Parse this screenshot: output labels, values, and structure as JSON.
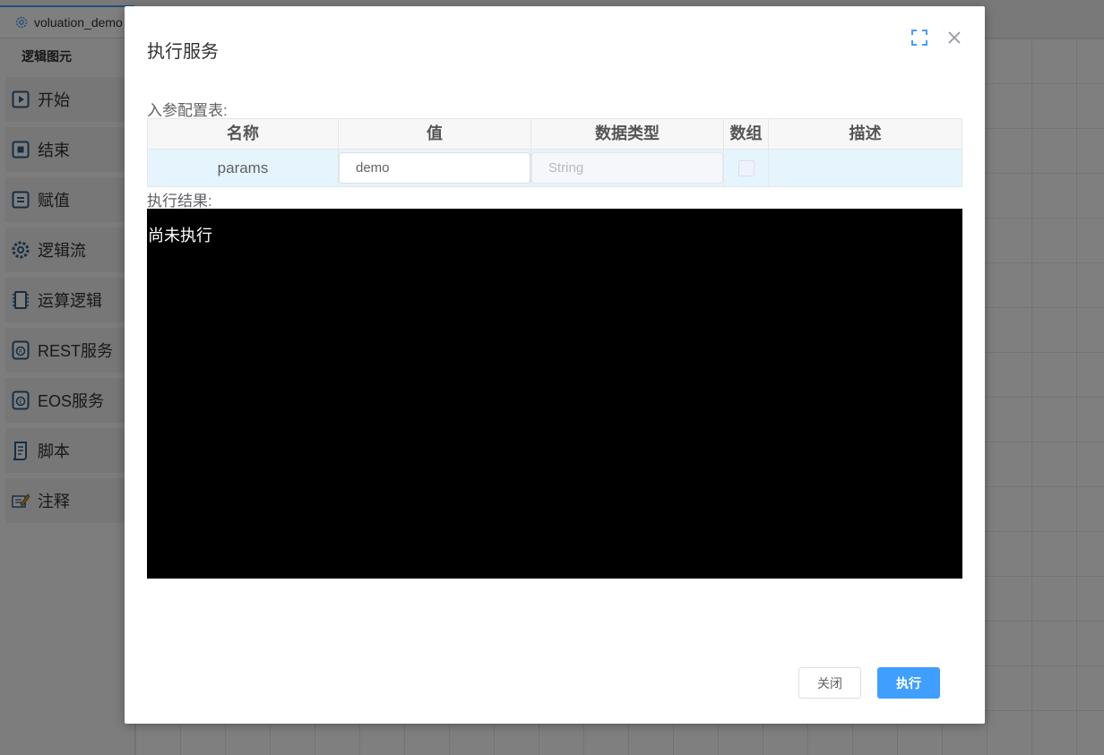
{
  "background": {
    "tab": {
      "label": "voluation_demo"
    },
    "sidebar": {
      "title": "逻辑图元",
      "items": [
        {
          "label": "开始",
          "icon": "play-icon"
        },
        {
          "label": "结束",
          "icon": "stop-icon"
        },
        {
          "label": "赋值",
          "icon": "equals-icon"
        },
        {
          "label": "逻辑流",
          "icon": "gear-icon"
        },
        {
          "label": "运算逻辑",
          "icon": "chip-icon"
        },
        {
          "label": "REST服务",
          "icon": "rest-service-icon"
        },
        {
          "label": "EOS服务",
          "icon": "eos-service-icon"
        },
        {
          "label": "脚本",
          "icon": "script-icon"
        },
        {
          "label": "注释",
          "icon": "comment-pencil-icon"
        }
      ]
    }
  },
  "dialog": {
    "title": "执行服务",
    "param_section_label": "入参配置表:",
    "param_table": {
      "headers": [
        "名称",
        "值",
        "数据类型",
        "数组",
        "描述"
      ],
      "rows": [
        {
          "name": "params",
          "value": "demo",
          "type": "String",
          "is_array": false,
          "description": ""
        }
      ]
    },
    "result_section_label": "执行结果:",
    "result_text": "尚未执行",
    "buttons": {
      "close": "关闭",
      "run": "执行"
    }
  },
  "colors": {
    "accent": "#409eff",
    "row_highlight": "#e5f4fd",
    "console_bg": "#000000",
    "overlay": "rgba(0,0,0,0.5)"
  }
}
